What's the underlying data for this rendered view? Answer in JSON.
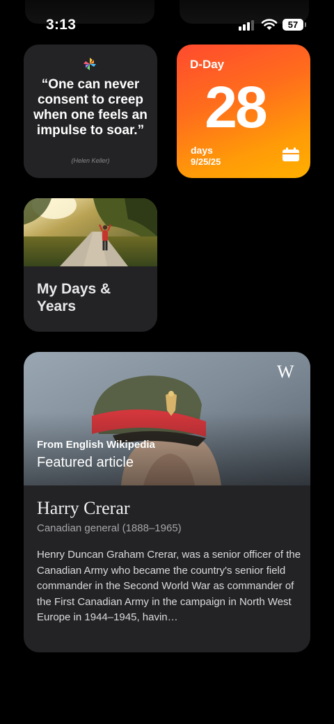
{
  "status_bar": {
    "time": "3:13",
    "battery_level": "57",
    "signal_bars_active": 3
  },
  "quote_widget": {
    "icon": "pinwheel-icon",
    "quote": "“One can never consent to creep when one feels an impulse to soar.”",
    "author": "(Helen Keller)"
  },
  "dday_widget": {
    "title": "D-Day",
    "count": "28",
    "unit": "days",
    "date": "9/25/25",
    "icon": "calendar-icon",
    "colors": {
      "start": "#ff4a2f",
      "end": "#ffb000"
    }
  },
  "mydays_widget": {
    "title": "My Days & Years",
    "photo": "person-walking-on-country-road"
  },
  "wikipedia_widget": {
    "logo": "W",
    "source": "From English Wikipedia",
    "kicker": "Featured article",
    "title": "Harry Crerar",
    "subtitle": "Canadian general (1888–1965)",
    "summary": "Henry Duncan Graham Crerar, was a senior officer of the Canadian Army who became the country's senior field commander in the Second World War as commander of the First Canadian Army in the campaign in North West Europe in 1944–1945, havin…",
    "photo": "portrait-of-army-officer-in-peaked-cap"
  }
}
